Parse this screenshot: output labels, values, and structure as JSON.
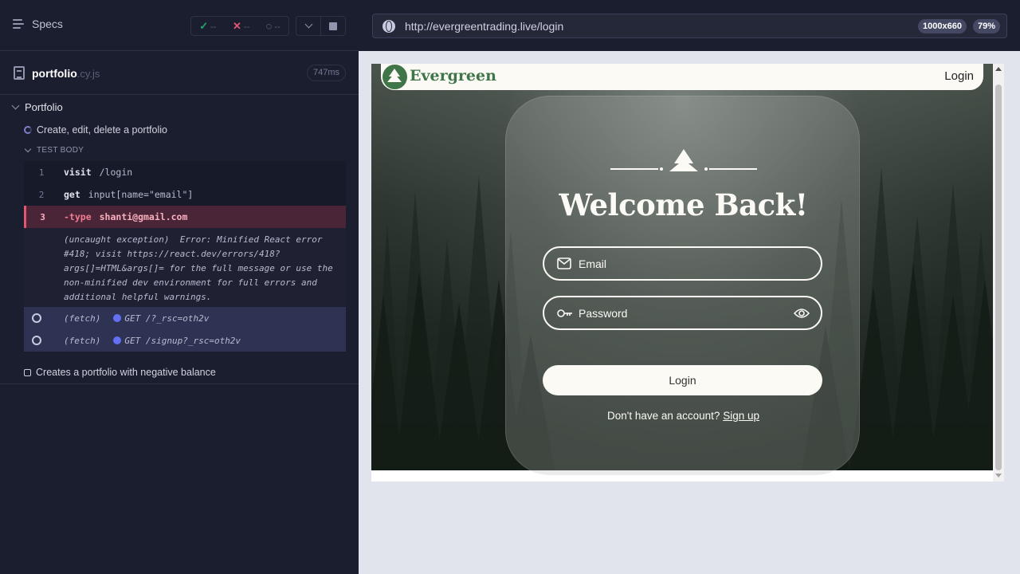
{
  "runner": {
    "specs_label": "Specs",
    "stats": {
      "passed": "--",
      "failed": "--",
      "pending": "--"
    },
    "spec_file": {
      "name": "portfolio",
      "ext": ".cy.js",
      "duration": "747ms"
    },
    "suite_title": "Portfolio",
    "test_title": "Create, edit, delete a portfolio",
    "test_body_label": "TEST BODY",
    "commands": [
      {
        "num": "1",
        "name": "visit",
        "message": "/login"
      },
      {
        "num": "2",
        "name": "get",
        "message": "input[name=\"email\"]"
      },
      {
        "num": "3",
        "name": "-type",
        "message": "shanti@gmail.com"
      }
    ],
    "error_text": "(uncaught exception)  Error: Minified React error #418; visit https://react.dev/errors/418? args[]=HTML&args[]= for the full message or use the non-minified dev environment for full errors and additional helpful warnings.",
    "fetches": [
      {
        "label": "(fetch)",
        "message": "GET /?_rsc=oth2v"
      },
      {
        "label": "(fetch)",
        "message": "GET /signup?_rsc=oth2v"
      }
    ],
    "test2_title": "Creates a portfolio with negative balance"
  },
  "aut": {
    "url": "http://evergreentrading.live/login",
    "viewport_size": "1000x660",
    "zoom": "79%"
  },
  "site": {
    "brand": "Evergreen",
    "nav_login": "Login",
    "heading": "Welcome Back!",
    "email_placeholder": "Email",
    "password_placeholder": "Password",
    "login_button": "Login",
    "signup_prompt": "Don't have an account?",
    "signup_link": "Sign up"
  },
  "colors": {
    "runner_bg": "#1b1e2e",
    "fail_red": "#e45770",
    "pass_green": "#1fa971",
    "brand_green": "#3f7549",
    "cream": "#fbfaf5"
  }
}
